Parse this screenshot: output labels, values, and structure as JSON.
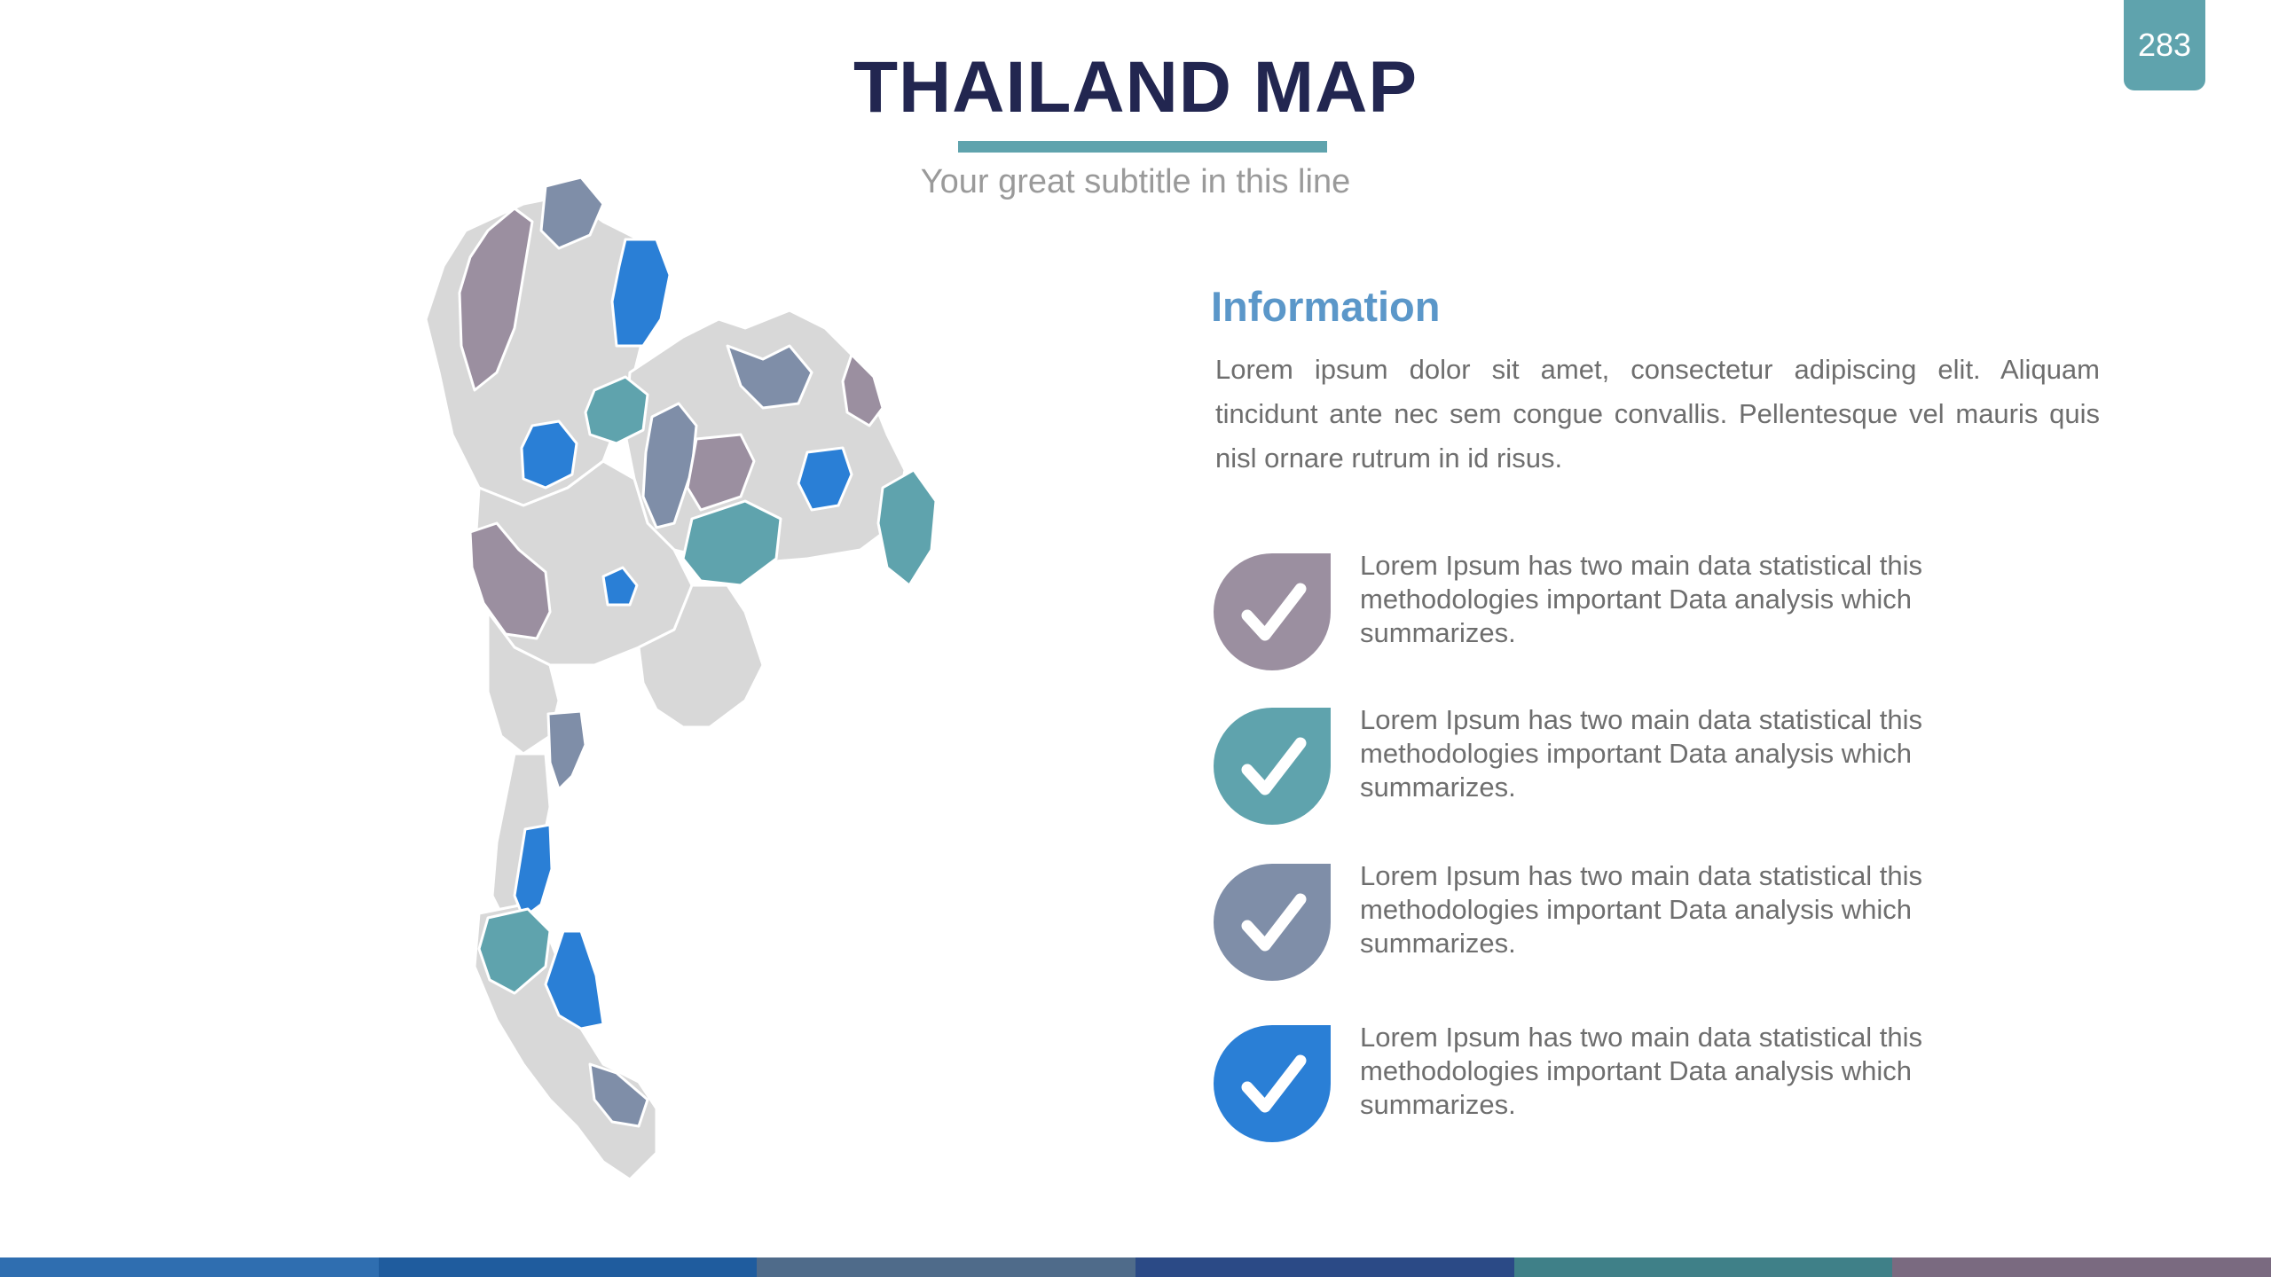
{
  "page_number": "283",
  "title": "THAILAND MAP",
  "subtitle": "Your great subtitle in this line",
  "info": {
    "heading": "Information",
    "body": "Lorem ipsum dolor sit amet, consectetur adipiscing elit. Aliquam tincidunt ante nec sem congue convallis. Pellentesque vel mauris quis nisl ornare rutrum in id risus."
  },
  "items": [
    {
      "text": "Lorem Ipsum has two main data statistical this methodologies important Data analysis which summarizes.",
      "color": "#9b8fa0",
      "icon": "check-icon"
    },
    {
      "text": "Lorem Ipsum has two main data statistical this methodologies important Data analysis which summarizes.",
      "color": "#5fa3ad",
      "icon": "check-icon"
    },
    {
      "text": "Lorem Ipsum has two main data statistical this methodologies important Data analysis which summarizes.",
      "color": "#7f8ea8",
      "icon": "check-icon"
    },
    {
      "text": "Lorem Ipsum has two main data statistical this methodologies important Data analysis which summarizes.",
      "color": "#2a7fd6",
      "icon": "check-icon"
    }
  ],
  "colors": {
    "title": "#222650",
    "accent": "#5fa3ad",
    "heading": "#5b97c9",
    "map_base": "#d8d8d8",
    "map_mauve": "#9b8fa0",
    "map_teal": "#5fa3ad",
    "map_slate": "#7f8ea8",
    "map_blue": "#2a7fd6"
  },
  "bottom_bar_colors": [
    "#2f6eb0",
    "#1f5c9e",
    "#4f6b8a",
    "#2b4a86",
    "#3f8088",
    "#7a6a80"
  ]
}
